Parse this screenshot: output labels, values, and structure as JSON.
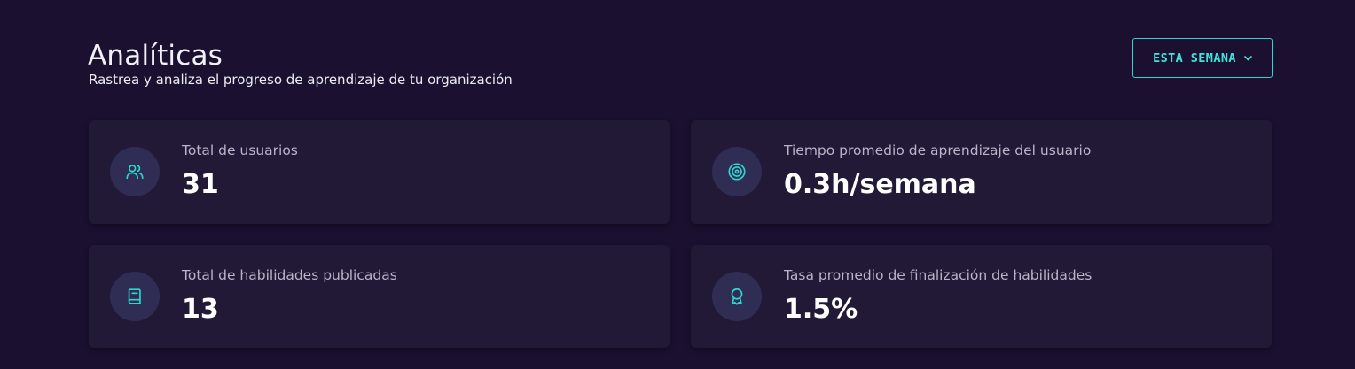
{
  "header": {
    "title": "Analíticas",
    "subtitle": "Rastrea y analiza el progreso de aprendizaje de tu organización"
  },
  "range_selector": {
    "label": "ESTA SEMANA",
    "icon": "chevron-down-icon"
  },
  "stats": {
    "total_users": {
      "label": "Total de usuarios",
      "value": "31",
      "icon": "users-icon"
    },
    "avg_learning_time": {
      "label": "Tiempo promedio de aprendizaje del usuario",
      "value": "0.3h/semana",
      "icon": "target-icon"
    },
    "published_skills": {
      "label": "Total de habilidades publicadas",
      "value": "13",
      "icon": "book-icon"
    },
    "completion_rate": {
      "label": "Tasa promedio de finalización de habilidades",
      "value": "1.5%",
      "icon": "award-icon"
    }
  },
  "colors": {
    "background": "#1b1030",
    "card": "#221937",
    "accent": "#2fd6d0",
    "icon_circle": "#2f2d54"
  }
}
